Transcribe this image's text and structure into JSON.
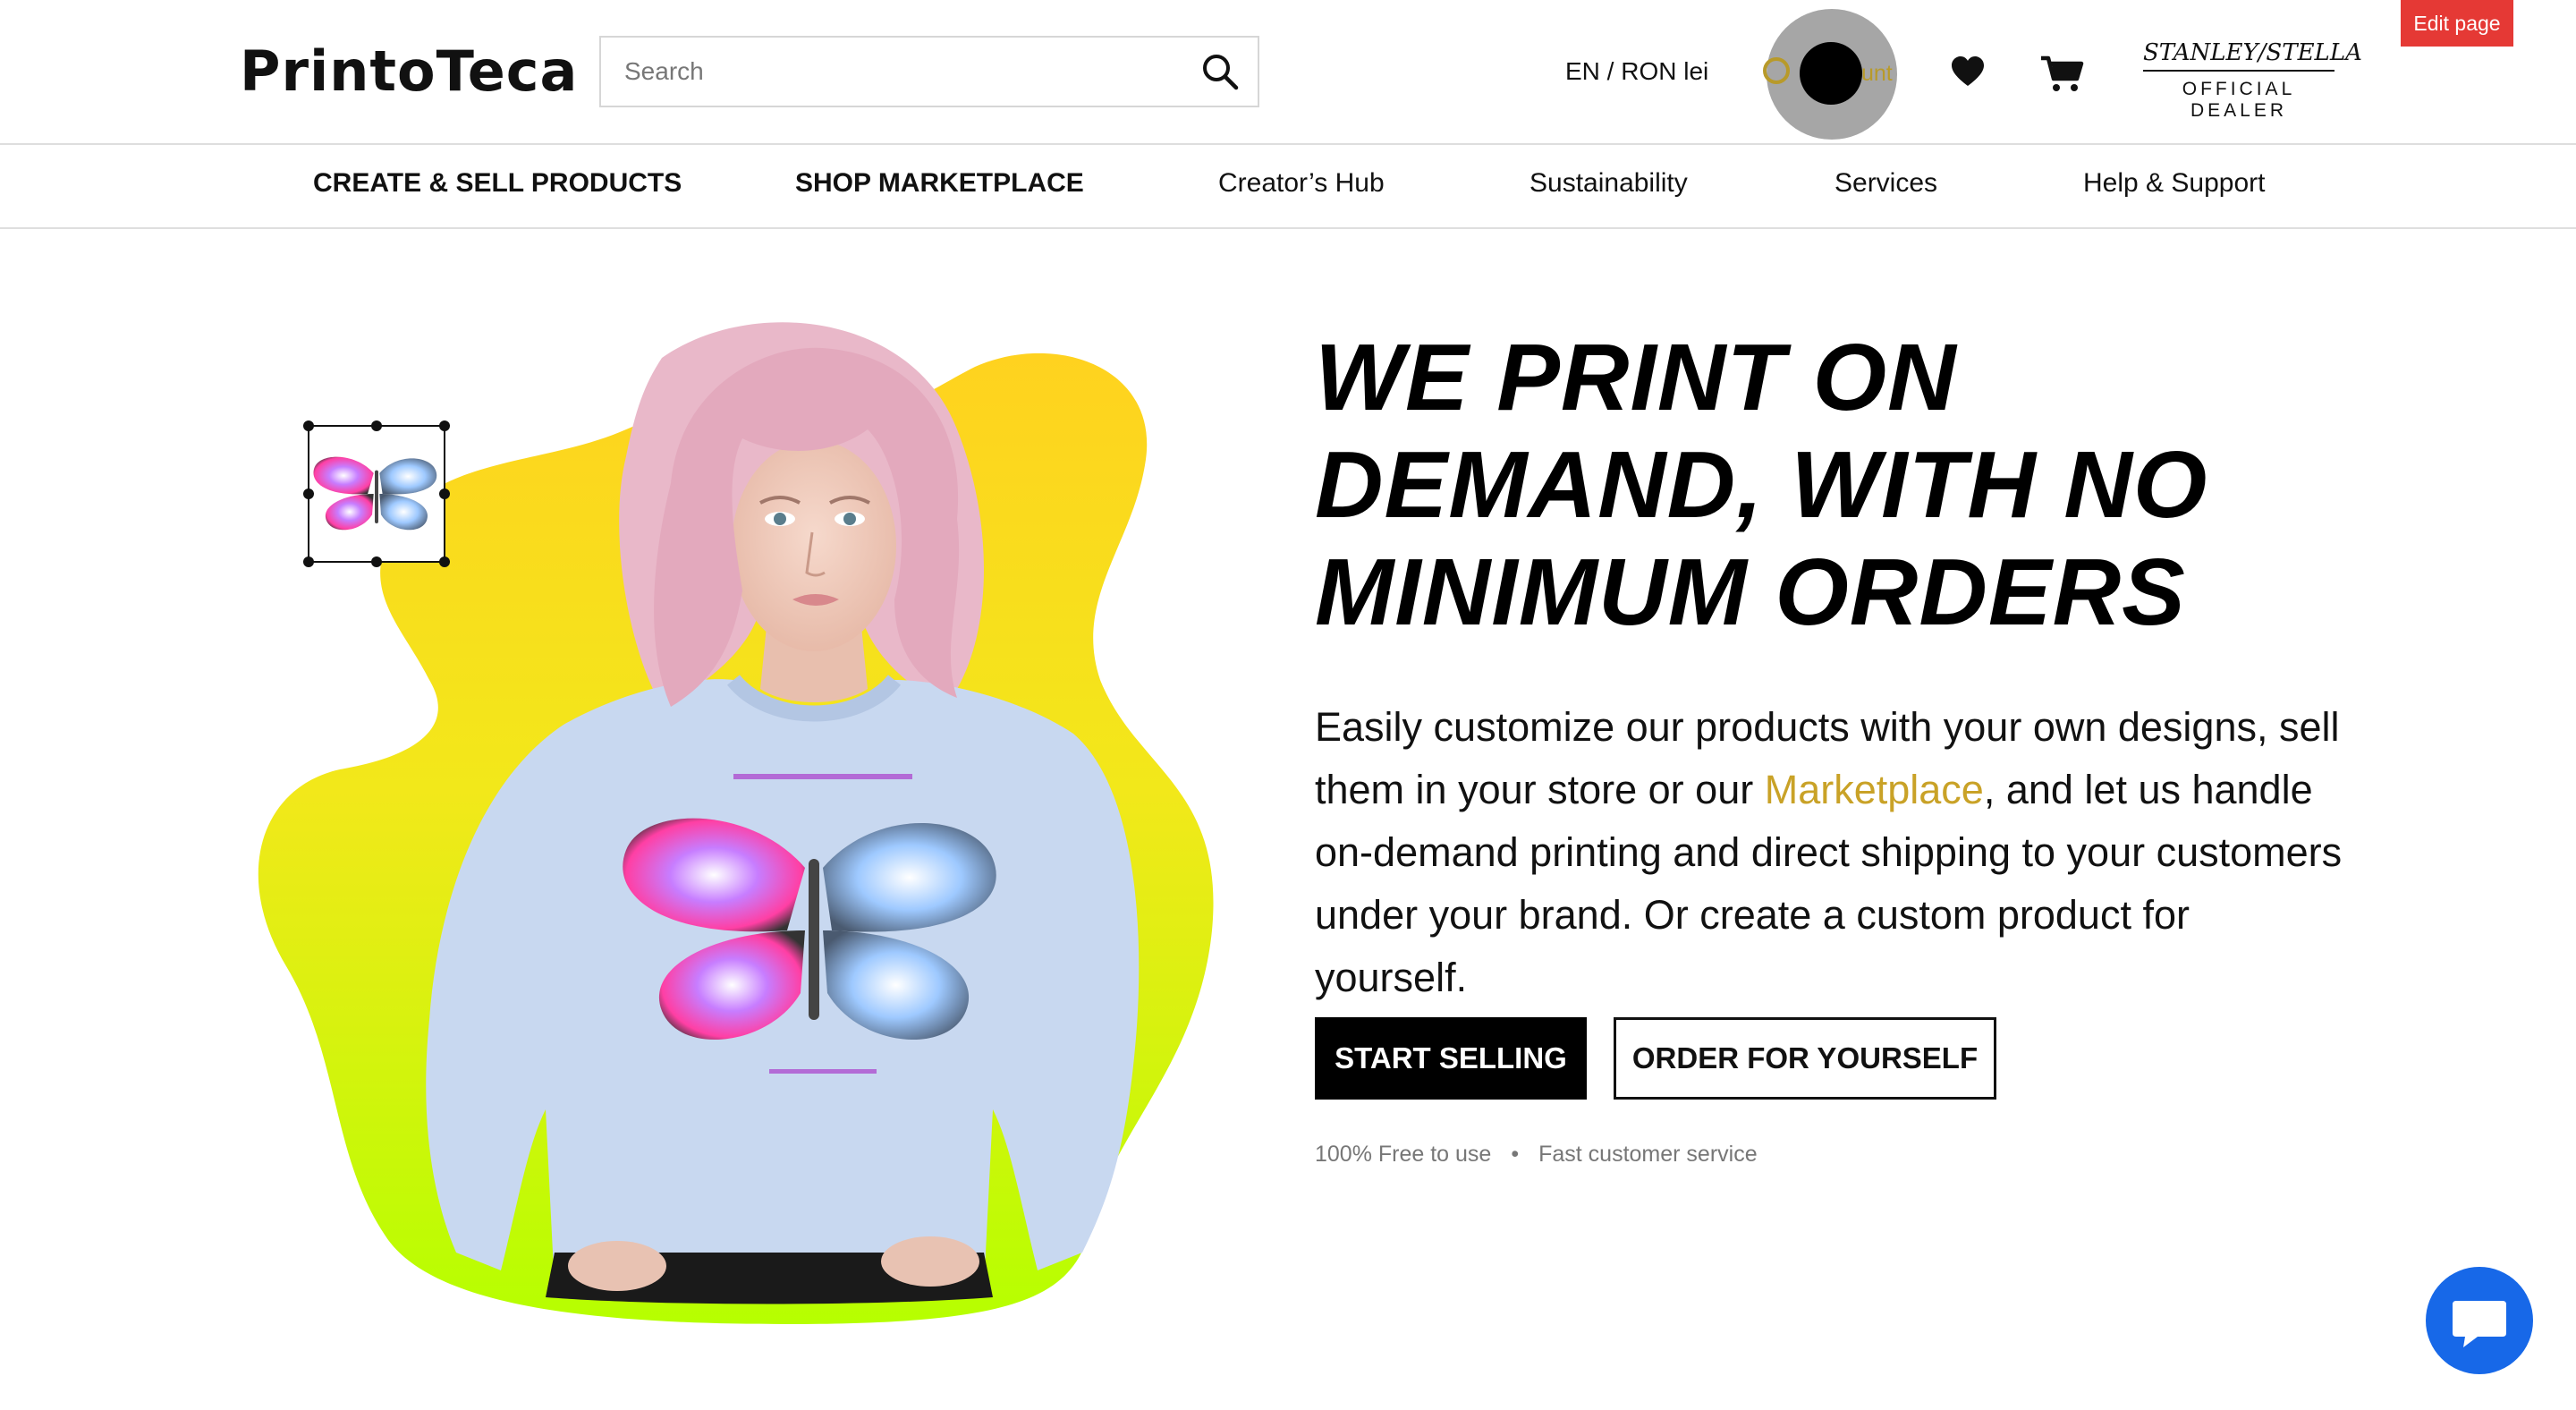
{
  "header": {
    "logo": "PrintoTeca",
    "search_placeholder": "Search",
    "language_currency": "EN / RON lei",
    "account_label": "unt",
    "dealer_brand": "STANLEY/STELLA",
    "dealer_sub": "OFFICIAL DEALER",
    "edit_page": "Edit page"
  },
  "nav": {
    "items": [
      "CREATE & SELL PRODUCTS",
      "SHOP MARKETPLACE",
      "Creator’s Hub",
      "Sustainability",
      "Services",
      "Help & Support"
    ]
  },
  "hero": {
    "headline": [
      "WE PRINT ON",
      "DEMAND, WITH NO",
      "MINIMUM ORDERS"
    ],
    "desc_before": "Easily customize our products with your own designs, sell them in your store or our ",
    "desc_link": "Marketplace",
    "desc_after": ", and let us handle on-demand printing and direct shipping to your customers under your brand. Or create a custom product for yourself.",
    "primary_button": "START SELLING",
    "secondary_button": "ORDER FOR YOURSELF",
    "perks": [
      "100% Free to use",
      "Fast customer service"
    ],
    "perk_separator": "•"
  },
  "icons": {
    "search": "search-icon",
    "account": "user-icon",
    "wishlist": "heart-icon",
    "cart": "cart-icon",
    "chat": "chat-icon"
  },
  "colors": {
    "accent_gold": "#c9a227",
    "edit_red": "#e53935",
    "chat_blue": "#1768e8",
    "blob_yellow": "#ffd21f",
    "blob_lime": "#b6ff00"
  }
}
